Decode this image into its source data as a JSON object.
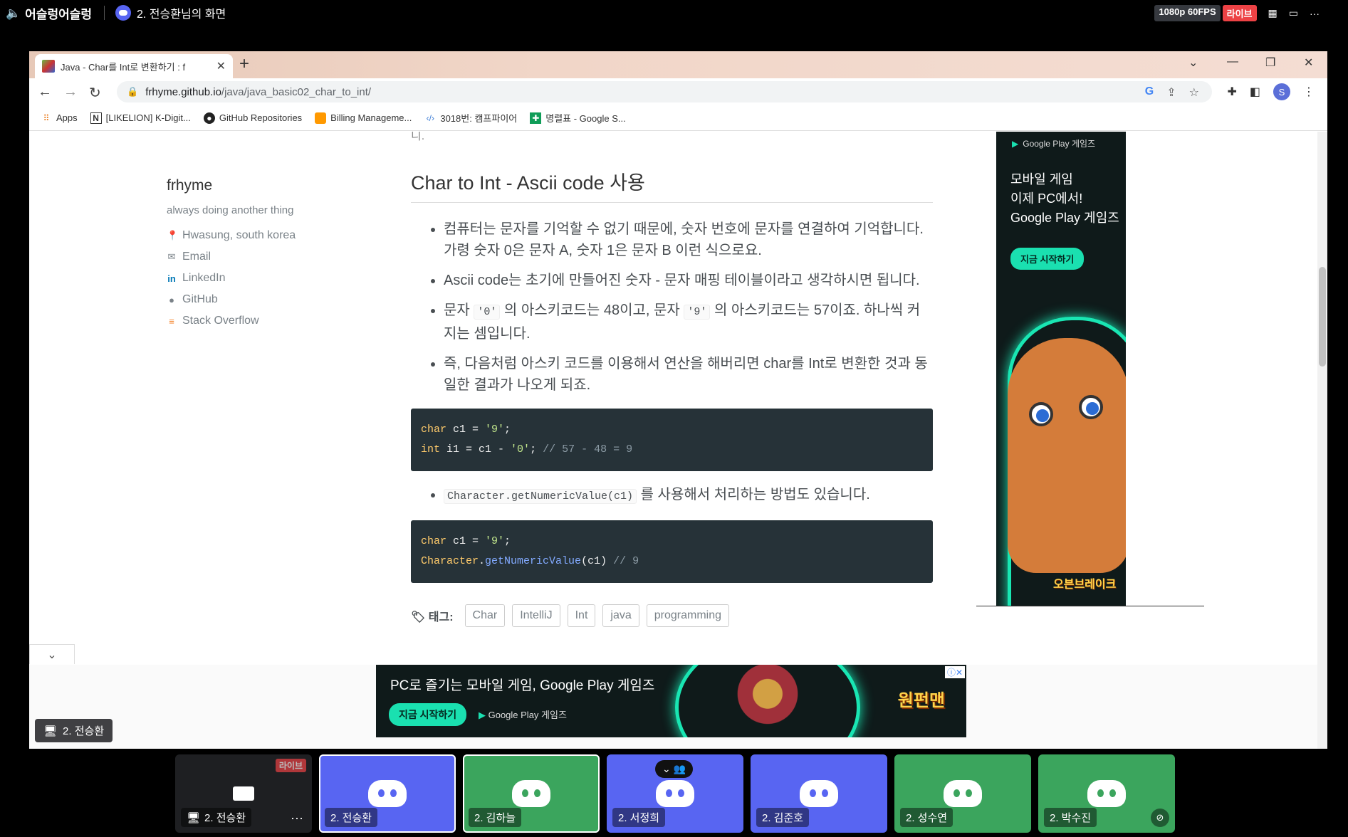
{
  "discord": {
    "channel_name": "어슬렁어슬렁",
    "screen_title": "2. 전승환님의 화면",
    "quality": "1080p 60FPS",
    "live": "라이브"
  },
  "browser": {
    "tab_title": "Java - Char를 Int로 변환하기 : f",
    "url_host": "frhyme.github.io",
    "url_path": "/java/java_basic02_char_to_int/",
    "avatar_letter": "S",
    "bookmarks": [
      {
        "label": "Apps",
        "icon": "apps-grid-icon"
      },
      {
        "label": "[LIKELION] K-Digit...",
        "icon": "notion-icon"
      },
      {
        "label": "GitHub Repositories",
        "icon": "github-icon"
      },
      {
        "label": "Billing Manageme...",
        "icon": "billing-box-icon"
      },
      {
        "label": "3018번: 캠프파이어",
        "icon": "code-icon"
      },
      {
        "label": "명렬표 - Google S...",
        "icon": "sheets-icon"
      }
    ]
  },
  "sidebar": {
    "name": "frhyme",
    "bio": "always doing another thing",
    "links": [
      {
        "icon": "location-pin-icon",
        "label": "Hwasung, south korea"
      },
      {
        "icon": "email-icon",
        "label": "Email"
      },
      {
        "icon": "linkedin-icon",
        "label": "LinkedIn"
      },
      {
        "icon": "github-icon",
        "label": "GitHub"
      },
      {
        "icon": "stackoverflow-icon",
        "label": "Stack Overflow"
      }
    ]
  },
  "article": {
    "cut_text": "니.",
    "heading": "Char to Int - Ascii code 사용",
    "bullet1": "컴퓨터는 문자를 기억할 수 없기 때문에, 숫자 번호에 문자를 연결하여 기억합니다. 가령 숫자 0은 문자 A, 숫자 1은 문자 B 이런 식으로요.",
    "bullet2": "Ascii code는 초기에 만들어진 숫자 - 문자 매핑 테이블이라고 생각하시면 됩니다.",
    "bullet3_a": "문자 ",
    "bullet3_code1": "'0'",
    "bullet3_b": " 의 아스키코드는 48이고, 문자 ",
    "bullet3_code2": "'9'",
    "bullet3_c": " 의 아스키코드는 57이죠. 하나씩 커지는 셈입니다.",
    "bullet4": "즉, 다음처럼 아스키 코드를 이용해서 연산을 해버리면 char를 Int로 변환한 것과 동일한 결과가 나오게 되죠.",
    "code1": {
      "l1_kw": "char",
      "l1_rest": " c1 = ",
      "l1_str": "'9'",
      "l1_end": ";",
      "l2_kw": "int",
      "l2_rest": " i1 = c1 - ",
      "l2_str": "'0'",
      "l2_end": "; ",
      "l2_comment": "// 57 - 48 = 9"
    },
    "bullet5_code": "Character.getNumericValue(c1)",
    "bullet5_text": " 를 사용해서 처리하는 방법도 있습니다.",
    "code2": {
      "l1_kw": "char",
      "l1_rest": " c1 = ",
      "l1_str": "'9'",
      "l1_end": ";",
      "l2_cls": "Character",
      "l2_dot": ".",
      "l2_fn": "getNumericValue",
      "l2_rest": "(c1) ",
      "l2_comment": "// 9"
    },
    "tags_label": "태그:",
    "tags": [
      "Char",
      "IntelliJ",
      "Int",
      "java",
      "programming"
    ]
  },
  "ads": {
    "side": {
      "brand": "Google Play 게임즈",
      "headline1": "모바일 게임",
      "headline2": "이제 PC에서!",
      "headline3": "Google Play 게임즈",
      "cta": "지금 시작하기",
      "game": "오븐브레이크"
    },
    "bottom": {
      "text": "PC로 즐기는 모바일 게임, Google Play 게임즈",
      "cta": "지금 시작하기",
      "brand": "Google Play 게임즈",
      "game": "원펀맨"
    }
  },
  "share_label": "2. 전승환",
  "participants": [
    {
      "name": "2. 전승환",
      "type": "screen",
      "live": "라이브"
    },
    {
      "name": "2. 전승환",
      "type": "blue"
    },
    {
      "name": "2. 김하늘",
      "type": "green"
    },
    {
      "name": "2. 서정희",
      "type": "blue"
    },
    {
      "name": "2. 김준호",
      "type": "blue"
    },
    {
      "name": "2. 성수연",
      "type": "green"
    },
    {
      "name": "2. 박수진",
      "type": "green"
    }
  ]
}
